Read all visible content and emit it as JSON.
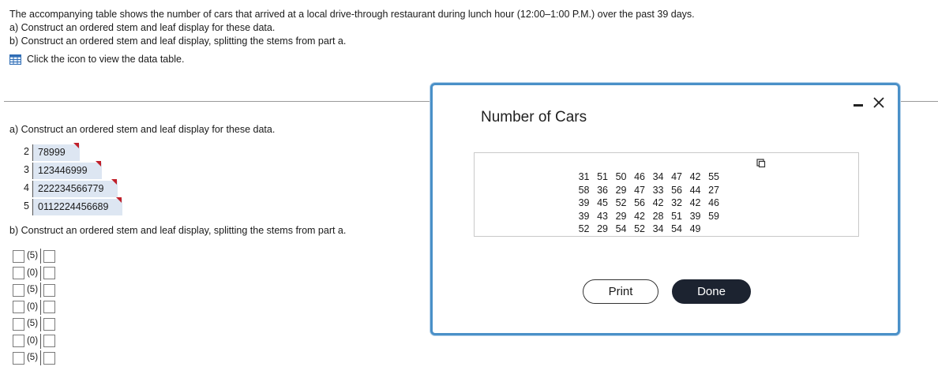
{
  "intro": {
    "line1": "The accompanying table shows the number of cars that arrived at a local drive-through restaurant during lunch hour (12:00–1:00 P.M.) over the past 39 days.",
    "line2": "a) Construct an ordered stem and leaf display for these data.",
    "line3": "b) Construct an ordered stem and leaf display, splitting the stems from part a.",
    "table_link": "Click the icon to view the data table."
  },
  "part_a": {
    "label": "a) Construct an ordered stem and leaf display for these data.",
    "rows": [
      {
        "stem": "2",
        "leaves": "78999"
      },
      {
        "stem": "3",
        "leaves": "123446999"
      },
      {
        "stem": "4",
        "leaves": "222234566779"
      },
      {
        "stem": "5",
        "leaves": "0112224456689"
      }
    ]
  },
  "part_b": {
    "label": "b) Construct an ordered stem and leaf display, splitting the stems from part a.",
    "stems": [
      "(5)",
      "(0)",
      "(5)",
      "(0)",
      "(5)",
      "(0)",
      "(5)"
    ]
  },
  "dialog": {
    "title": "Number of Cars",
    "rows": [
      [
        "31",
        "51",
        "50",
        "46",
        "34",
        "47",
        "42",
        "55"
      ],
      [
        "58",
        "36",
        "29",
        "47",
        "33",
        "56",
        "44",
        "27"
      ],
      [
        "39",
        "45",
        "52",
        "56",
        "42",
        "32",
        "42",
        "46"
      ],
      [
        "39",
        "43",
        "29",
        "42",
        "28",
        "51",
        "39",
        "59"
      ],
      [
        "52",
        "29",
        "54",
        "52",
        "34",
        "54",
        "49",
        ""
      ]
    ],
    "print_label": "Print",
    "done_label": "Done"
  },
  "colors": {
    "accent_border": "#4a90c8",
    "leaf_fill": "#dde6f2",
    "flag": "#c0202a",
    "done_button": "#1c2330"
  }
}
